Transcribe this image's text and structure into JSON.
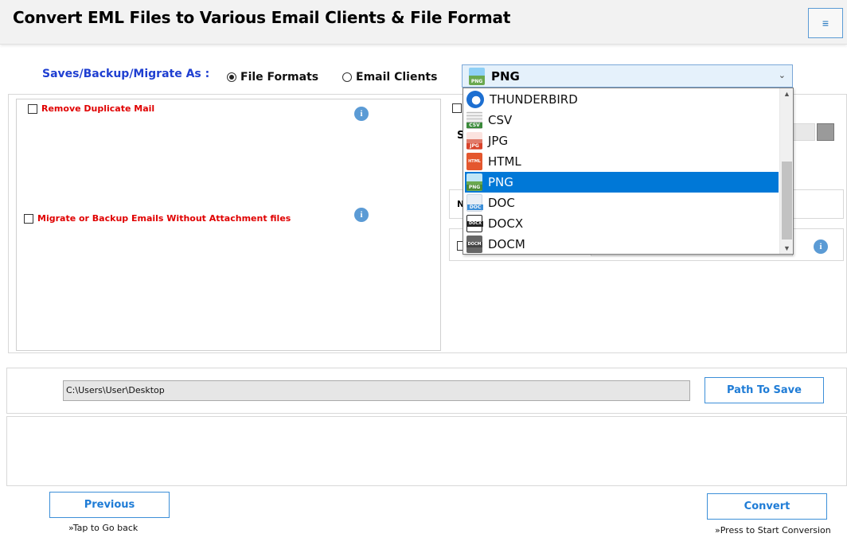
{
  "header": {
    "title": "Convert EML Files to Various Email Clients & File Format",
    "menu_icon": "hamburger-icon",
    "menu_glyph": "≡"
  },
  "saves": {
    "label": "Saves/Backup/Migrate As :",
    "options": [
      {
        "label": "File Formats",
        "selected": true
      },
      {
        "label": "Email Clients",
        "selected": false
      }
    ]
  },
  "format_select": {
    "value": "PNG",
    "icon": "png-file-icon",
    "chevron": "⌄",
    "options": [
      {
        "label": "THUNDERBIRD",
        "icon": "thunderbird-icon",
        "selected": false,
        "color": "#1d6fd1",
        "tag": ""
      },
      {
        "label": "CSV",
        "icon": "csv-file-icon",
        "selected": false,
        "color": "#3a8a3a",
        "tag": "CSV"
      },
      {
        "label": "JPG",
        "icon": "jpg-file-icon",
        "selected": false,
        "color": "#d9442b",
        "tag": "JPG"
      },
      {
        "label": "HTML",
        "icon": "html-file-icon",
        "selected": false,
        "color": "#e4572e",
        "tag": "HTML"
      },
      {
        "label": "PNG",
        "icon": "png-file-icon",
        "selected": true,
        "color": "#6aa84f",
        "tag": "PNG"
      },
      {
        "label": "DOC",
        "icon": "doc-file-icon",
        "selected": false,
        "color": "#3d8fd8",
        "tag": "DOC"
      },
      {
        "label": "DOCX",
        "icon": "docx-file-icon",
        "selected": false,
        "color": "#222222",
        "tag": "DOCX"
      },
      {
        "label": "DOCM",
        "icon": "docm-file-icon",
        "selected": false,
        "color": "#555555",
        "tag": "DOCM"
      }
    ]
  },
  "filters": {
    "remove_duplicate": {
      "label": "Remove Duplicate Mail",
      "checked": false
    },
    "without_attachment": {
      "label": "Migrate or Backup Emails Without Attachment files",
      "checked": false
    },
    "info_glyph": "i"
  },
  "right_panel": {
    "partial_s": "S",
    "partial_n": "N"
  },
  "path": {
    "value": "C:\\Users\\User\\Desktop",
    "button": "Path To Save"
  },
  "footer": {
    "previous": "Previous",
    "previous_hint": "»Tap to Go back",
    "convert": "Convert",
    "convert_hint": "»Press to Start Conversion"
  }
}
